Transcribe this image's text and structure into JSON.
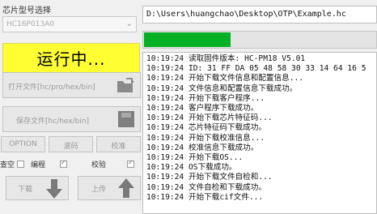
{
  "chip": {
    "label": "芯片型号选择",
    "value": "HC16P013A0",
    "dropdown_icon": "chevron-down"
  },
  "status": {
    "text": "运行中..."
  },
  "buttons": {
    "open_file": "打开文件[hc/pro/hex/bin]",
    "save_file": "保存文件[hc/hex/bin]",
    "option": "OPTION",
    "password": "滚码",
    "calibrate": "校准",
    "download": "下载",
    "upload": "上传"
  },
  "checks": [
    {
      "label": "查空",
      "checked": false
    },
    {
      "label": "编程",
      "checked": true
    },
    {
      "label": "校验",
      "checked": true
    }
  ],
  "file_path": "D:\\Users\\huangchao\\Desktop\\OTP\\Example.hc",
  "progress": {
    "percent": 38,
    "color": "#06b025"
  },
  "log": [
    "10:19:24 读取固件版本:  HC-PM18 V5.01",
    "10:19:24 ID: 31 FF DA 05 48 58 30 33 14 64 16 5",
    "10:19:24 开始下载文件信息和配置信息...",
    "10:19:24 文件信息和配置信息下载成功。",
    "10:19:24 开始下载客户程序...",
    "10:19:24 客户程序下载成功。",
    "10:19:24 开始下载芯片特征码...",
    "10:19:24 芯片特征码下载成功。",
    "10:19:24 开始下载校准信息...",
    "10:19:24 校准信息下载成功。",
    "10:19:24 开始下载OS...",
    "10:19:24 OS下载成功。",
    "10:19:24 开始下载文件自检和...",
    "10:19:24 文件自检和下载成功。",
    "10:19:24 开始下载cif文件..."
  ]
}
